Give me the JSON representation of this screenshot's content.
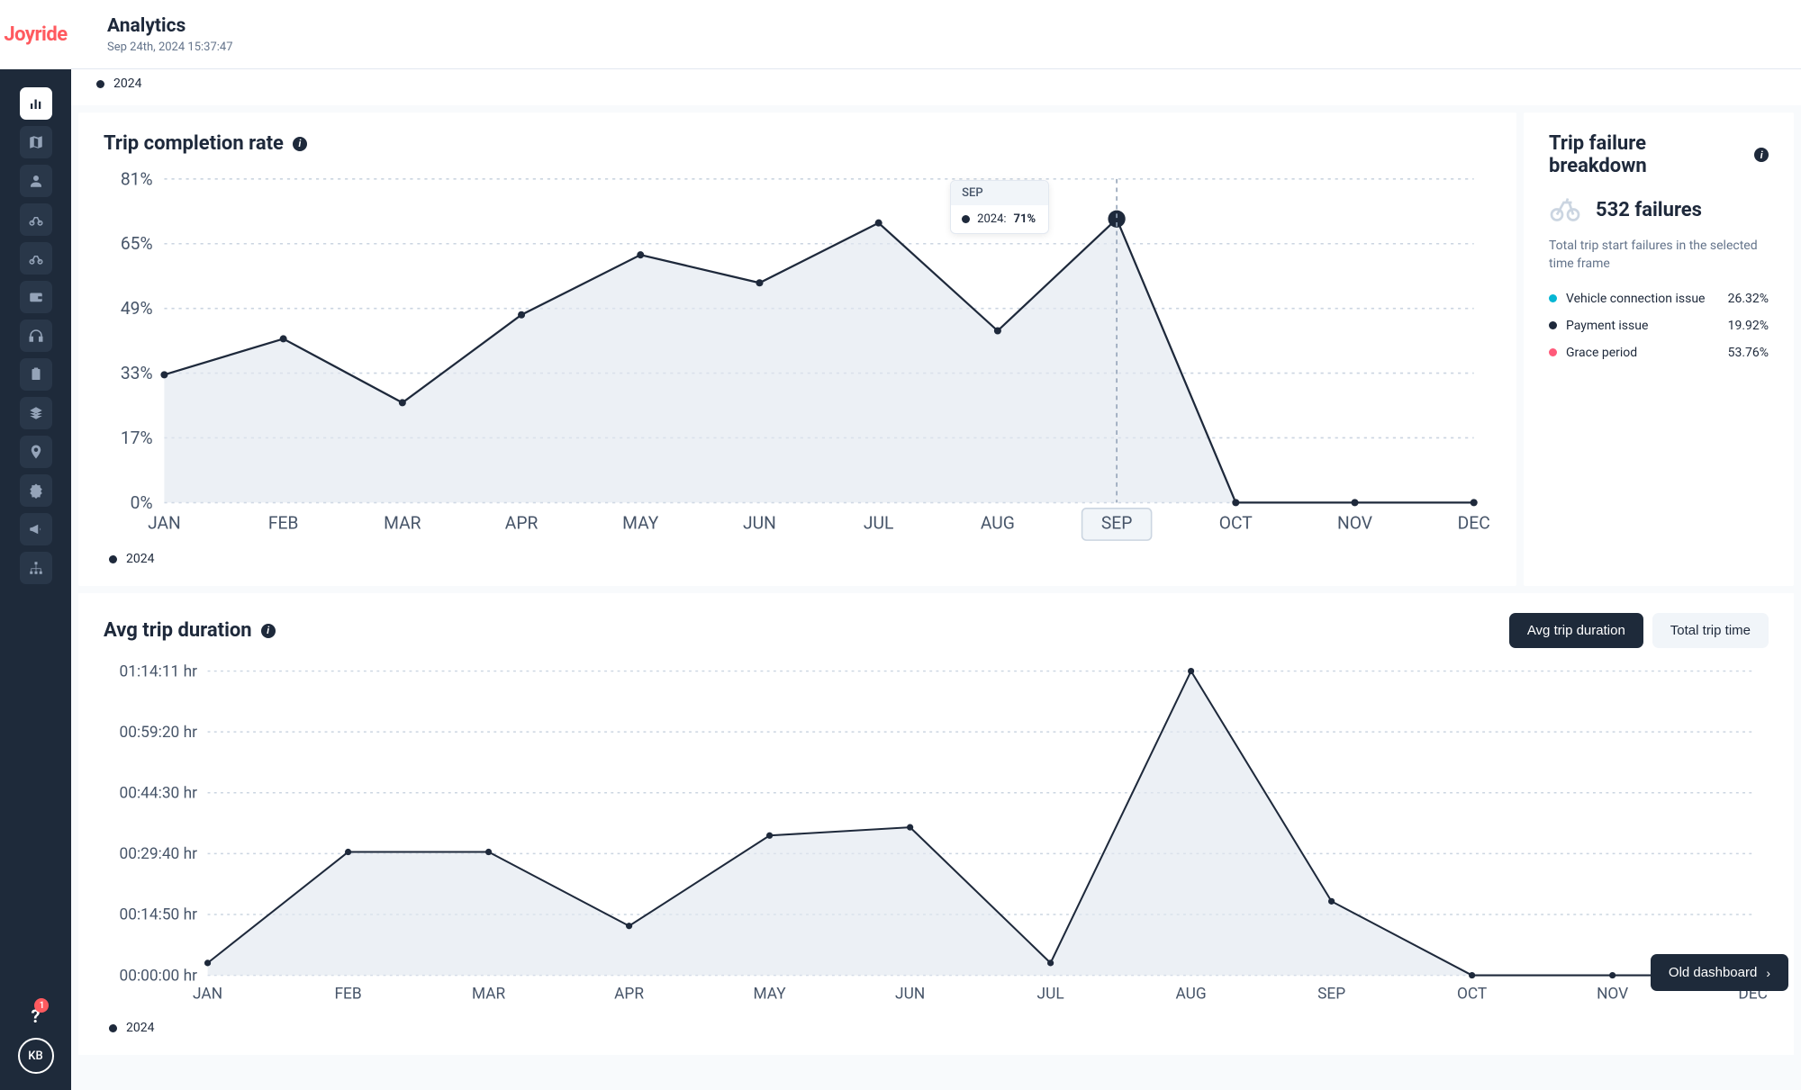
{
  "brand": "Joyride",
  "header": {
    "title": "Analytics",
    "timestamp": "Sep 24th, 2024 15:37:47"
  },
  "top_legend": "2024",
  "completion": {
    "title": "Trip completion rate",
    "legend": "2024",
    "tooltip": {
      "month": "SEP",
      "series": "2024:",
      "value": "71%"
    }
  },
  "failure": {
    "title": "Trip failure breakdown",
    "count": "532 failures",
    "subtitle": "Total trip start failures in the selected time frame",
    "items": [
      {
        "label": "Vehicle connection issue",
        "pct": "26.32%",
        "color": "#06b6d4"
      },
      {
        "label": "Payment issue",
        "pct": "19.92%",
        "color": "#1e293b"
      },
      {
        "label": "Grace period",
        "pct": "53.76%",
        "color": "#ff5a7a"
      }
    ]
  },
  "duration": {
    "title": "Avg trip duration",
    "buttons": {
      "active": "Avg trip duration",
      "inactive": "Total trip time"
    },
    "legend": "2024"
  },
  "old_dashboard": "Old dashboard",
  "help_badge": "1",
  "avatar": "KB",
  "chart_data": [
    {
      "type": "area",
      "title": "Trip completion rate",
      "categories": [
        "JAN",
        "FEB",
        "MAR",
        "APR",
        "MAY",
        "JUN",
        "JUL",
        "AUG",
        "SEP",
        "OCT",
        "NOV",
        "DEC"
      ],
      "series": [
        {
          "name": "2024",
          "values": [
            32,
            41,
            25,
            47,
            62,
            55,
            70,
            43,
            71,
            0,
            0,
            0
          ]
        }
      ],
      "ylabel": "%",
      "ylim": [
        0,
        81
      ],
      "y_ticks": [
        "0%",
        "17%",
        "33%",
        "49%",
        "65%",
        "81%"
      ],
      "highlight": {
        "index": 8,
        "label": "SEP",
        "value": "71%"
      }
    },
    {
      "type": "area",
      "title": "Avg trip duration",
      "categories": [
        "JAN",
        "FEB",
        "MAR",
        "APR",
        "MAY",
        "JUN",
        "JUL",
        "AUG",
        "SEP",
        "OCT",
        "NOV",
        "DEC"
      ],
      "series": [
        {
          "name": "2024",
          "values_minutes": [
            3,
            30,
            30,
            12,
            34,
            36,
            3,
            74,
            18,
            0,
            0,
            0
          ]
        }
      ],
      "y_ticks": [
        "00:00:00 hr",
        "00:14:50 hr",
        "00:29:40 hr",
        "00:44:30 hr",
        "00:59:20 hr",
        "01:14:11 hr"
      ],
      "ylim_minutes": [
        0,
        74
      ]
    }
  ]
}
